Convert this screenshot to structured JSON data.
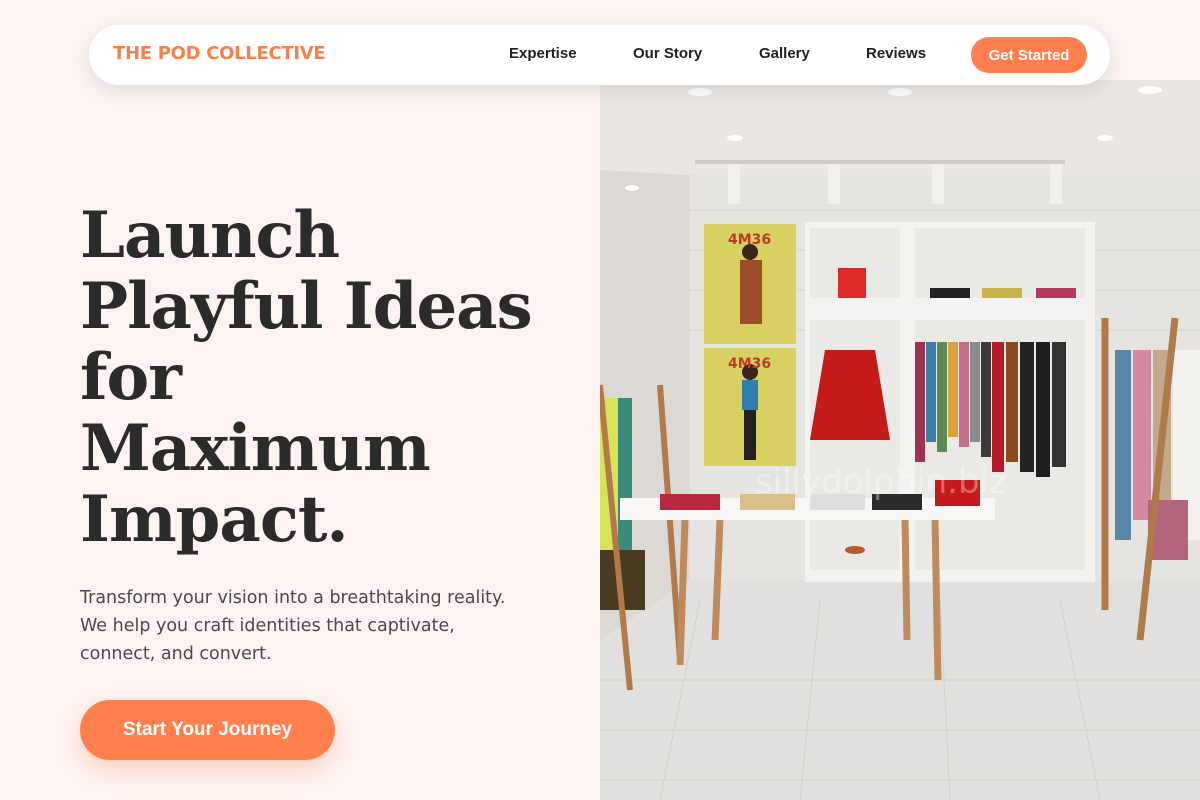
{
  "brand": {
    "name": "THE POD COLLECTIVE",
    "color": "#f4824d"
  },
  "nav": {
    "links": [
      "Expertise",
      "Our Story",
      "Gallery",
      "Reviews"
    ],
    "cta_label": "Get Started"
  },
  "hero": {
    "headline_lines": [
      "Launch",
      "Playful Ideas",
      "for",
      "Maximum",
      "Impact."
    ],
    "subtext_lines": [
      "Transform your vision into a breathtaking reality.",
      "We help you craft identities that captivate,",
      "connect, and convert."
    ],
    "cta_label": "Start Your Journey",
    "image_watermark": "sillydolphin.biz",
    "poster_label": "4M36"
  },
  "colors": {
    "accent": "#ff7f4f",
    "background": "#fdf3f1",
    "text": "#2b2b2b"
  }
}
